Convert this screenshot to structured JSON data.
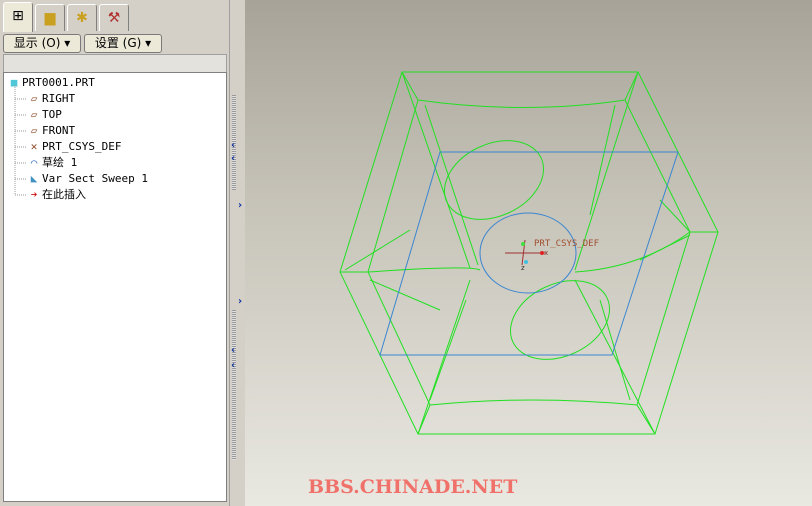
{
  "tabs": [
    {
      "icon": "model-tree-icon"
    },
    {
      "icon": "folder-browser-icon"
    },
    {
      "icon": "favorites-icon"
    },
    {
      "icon": "tools-icon"
    }
  ],
  "toolbar": {
    "show_label": "显示 (O) ▾",
    "settings_label": "设置 (G) ▾"
  },
  "tree": {
    "root": "PRT0001.PRT",
    "items": [
      {
        "label": "RIGHT",
        "icon": "datum-plane-icon"
      },
      {
        "label": "TOP",
        "icon": "datum-plane-icon"
      },
      {
        "label": "FRONT",
        "icon": "datum-plane-icon"
      },
      {
        "label": "PRT_CSYS_DEF",
        "icon": "coordinate-system-icon"
      },
      {
        "label": "草绘 1",
        "icon": "sketch-icon"
      },
      {
        "label": "Var Sect Sweep 1",
        "icon": "sweep-feature-icon"
      },
      {
        "label": "在此插入",
        "icon": "insert-here-arrow-icon"
      }
    ]
  },
  "viewport": {
    "csys_label": "PRT_CSYS_DEF",
    "axis_x": "x",
    "axis_z": "z",
    "wire_color": "#22e022",
    "sketch_color": "#3a86d0"
  },
  "watermark": "BBS.CHINADE.NET"
}
